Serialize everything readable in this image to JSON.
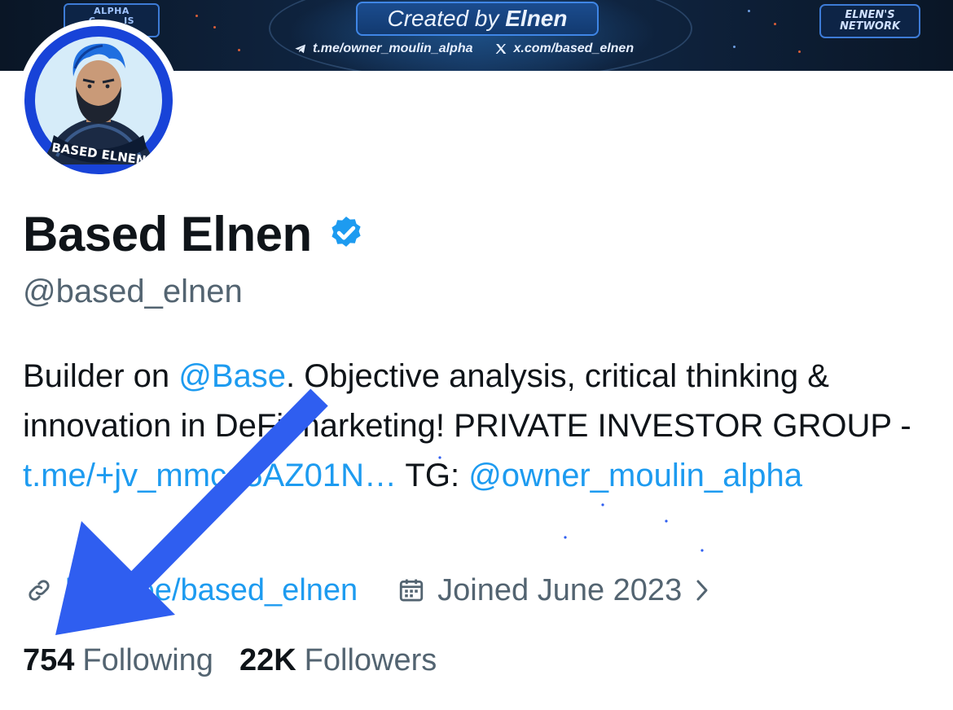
{
  "banner": {
    "created_prefix": "Created by",
    "created_name": "Elnen",
    "telegram_link": "t.me/owner_moulin_alpha",
    "x_link": "x.com/based_elnen",
    "badge_left_line1": "ALPHA",
    "badge_left_line2": "C        IS",
    "badge_right_line1": "ELNEN'S",
    "badge_right_line2": "NETWORK",
    "colors": {
      "accent": "#3f86e6",
      "background": "#0f2440"
    }
  },
  "avatar": {
    "ring_color": "#1843d8",
    "caption": "BASED ELNEN"
  },
  "profile": {
    "display_name": "Based Elnen",
    "handle": "@based_elnen",
    "verified_color": "#1d9bf0",
    "bio": {
      "part1": "Builder on ",
      "mention_base": "@Base",
      "part2": ". Objective analysis, critical thinking & innovation in De",
      "part2_hidden": "Fi",
      "part3": " marketing! PRIVATE INVESTOR GROUP - ",
      "tg_link": "t.me/+jv_mmcq5AZ01N…",
      "part4": " TG: ",
      "mention_owner": "@owner_moulin_alpha"
    },
    "website": "linktr.ee/based_elnen",
    "joined": "Joined June 2023",
    "stats": {
      "following_count": "754",
      "following_label": "Following",
      "followers_count": "22K",
      "followers_label": "Followers"
    }
  },
  "annotation": {
    "arrow_color": "#2f5ef0",
    "points_to": "following-count"
  }
}
